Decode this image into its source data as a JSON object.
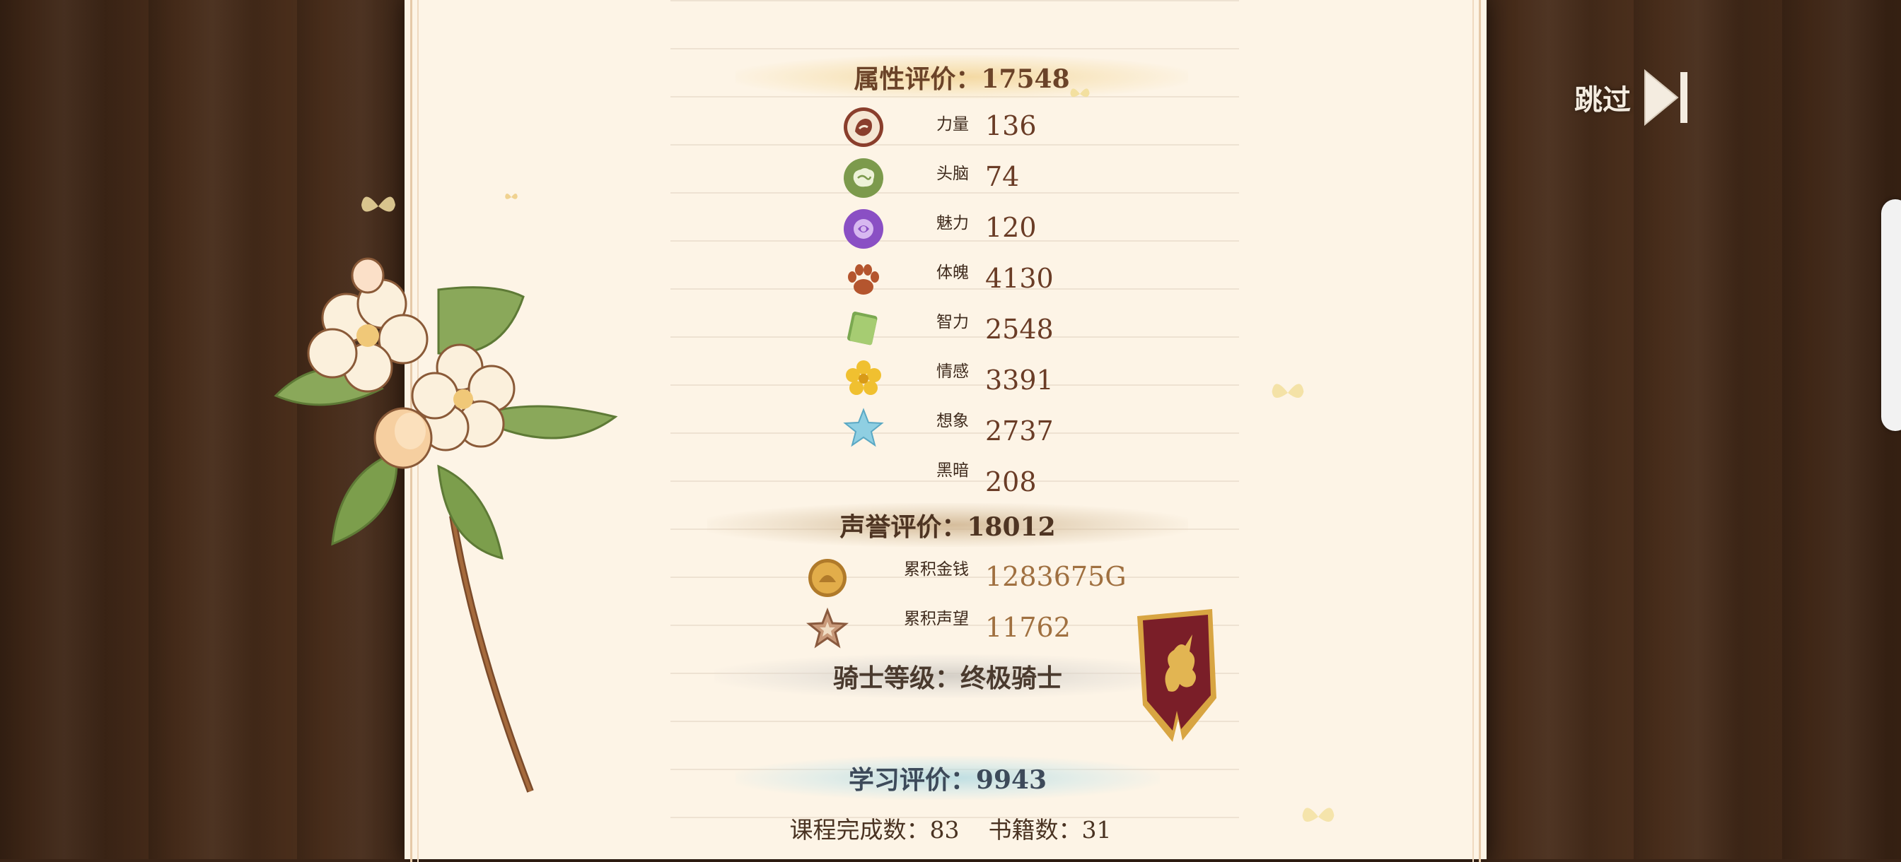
{
  "skip_label": "跳过",
  "attribute": {
    "title": "属性评价：17548",
    "stats": [
      {
        "label": "力量",
        "value": "136",
        "icon": "strength-icon"
      },
      {
        "label": "头脑",
        "value": "74",
        "icon": "brain-icon"
      },
      {
        "label": "魅力",
        "value": "120",
        "icon": "rose-icon"
      },
      {
        "label": "体魄",
        "value": "4130",
        "icon": "paw-icon"
      },
      {
        "label": "智力",
        "value": "2548",
        "icon": "book-icon"
      },
      {
        "label": "情感",
        "value": "3391",
        "icon": "flower-icon"
      },
      {
        "label": "想象",
        "value": "2737",
        "icon": "star-icon"
      },
      {
        "label": "黑暗",
        "value": "208",
        "icon": ""
      }
    ]
  },
  "reputation": {
    "title": "声誉评价：18012",
    "stats": [
      {
        "label": "累积金钱",
        "value": "1283675G",
        "icon": "coin-icon"
      },
      {
        "label": "累积声望",
        "value": "11762",
        "icon": "fame-star-icon"
      }
    ]
  },
  "knight": {
    "title": "骑士等级：终极骑士"
  },
  "study": {
    "title": "学习评价：9943",
    "courses": "课程完成数：83",
    "books": "书籍数：31"
  },
  "colors": {
    "paper": "#fdf4e6",
    "value_brown": "#6a3c26",
    "value_gold": "#a07040",
    "crest_red": "#7a1e28",
    "crest_gold": "#d8a542"
  }
}
